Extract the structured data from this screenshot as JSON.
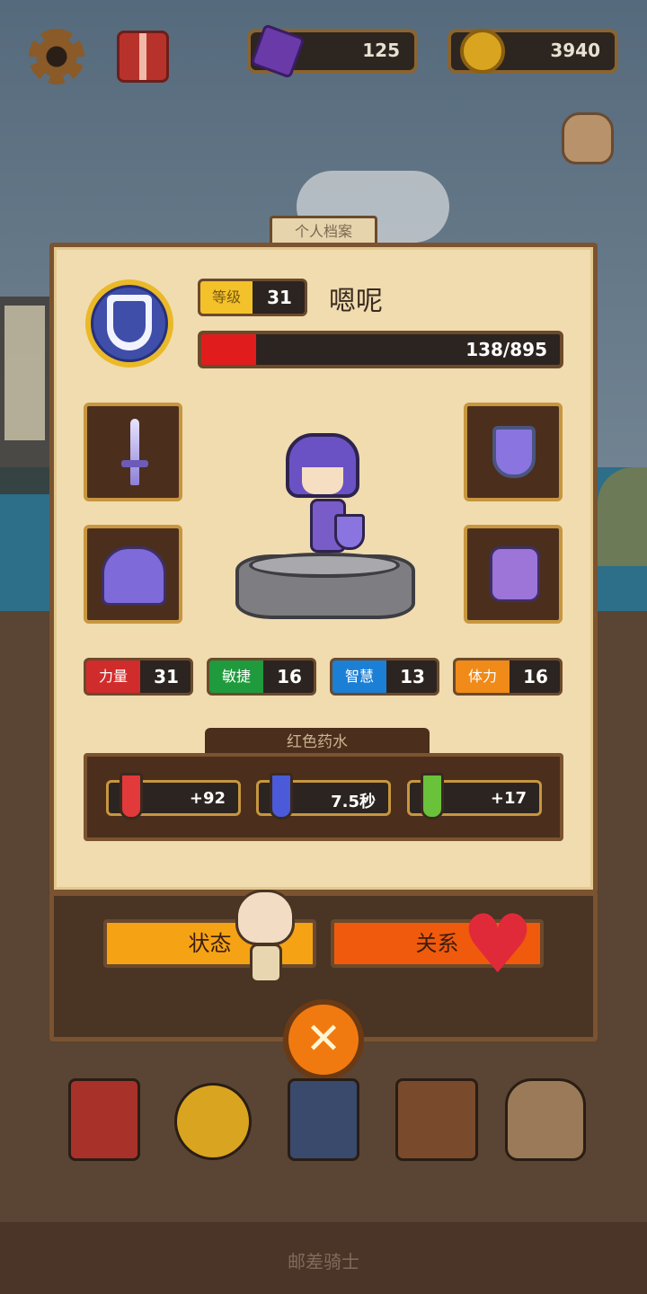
{
  "currency": {
    "gems": "125",
    "coins": "3940"
  },
  "profile": {
    "tab_label": "个人档案",
    "level_label": "等级",
    "level_value": "31",
    "name": "嗯呢",
    "hp_text": "138/895",
    "hp_fraction": 0.154
  },
  "stats": [
    {
      "label": "力量",
      "value": "31",
      "color": "#d12c2c"
    },
    {
      "label": "敏捷",
      "value": "16",
      "color": "#1f9a3d"
    },
    {
      "label": "智慧",
      "value": "13",
      "color": "#1c7fd6"
    },
    {
      "label": "体力",
      "value": "16",
      "color": "#f08a18"
    }
  ],
  "potion": {
    "title": "红色药水",
    "hp_bonus": "+92",
    "duration": "7.5秒",
    "extra_bonus": "+17"
  },
  "buttons": {
    "status": "状态",
    "relation": "关系"
  },
  "footer": {
    "title": "邮差骑士"
  },
  "icons": [
    "gear-icon",
    "gift-icon",
    "gem-icon",
    "coin-icon",
    "bag-icon",
    "emblem-icon",
    "sword-icon",
    "helmet-icon",
    "shield-icon",
    "armor-icon",
    "heart-icon",
    "close-icon",
    "book-icon",
    "medal-icon",
    "cards-icon",
    "backpack-icon",
    "treasure-bag-icon"
  ]
}
